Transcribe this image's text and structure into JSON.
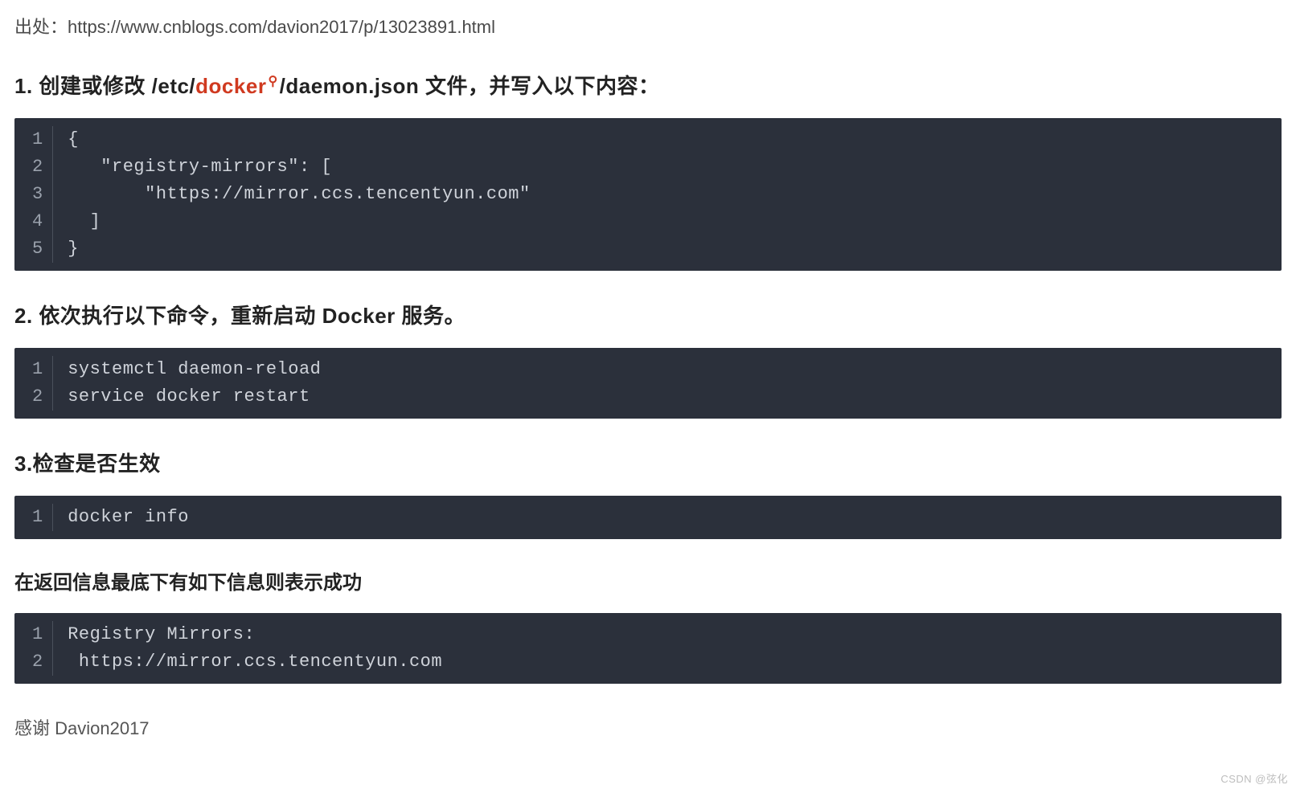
{
  "source": {
    "label": "出处：",
    "url": "https://www.cnblogs.com/davion2017/p/13023891.html"
  },
  "sections": {
    "s1": {
      "prefix": "1. 创建或修改 /etc/",
      "keyword": "docker",
      "suffix": "/daemon.json 文件，并写入以下内容：",
      "code": [
        "{",
        "   \"registry-mirrors\": [",
        "       \"https://mirror.ccs.tencentyun.com\"",
        "  ]",
        "}"
      ]
    },
    "s2": {
      "title": "2. 依次执行以下命令，重新启动 Docker 服务。",
      "code": [
        "systemctl daemon-reload",
        "service docker restart"
      ]
    },
    "s3": {
      "title": "3.检查是否生效",
      "code": [
        "docker info"
      ]
    },
    "s4": {
      "title": "在返回信息最底下有如下信息则表示成功",
      "code": [
        "Registry Mirrors:",
        " https://mirror.ccs.tencentyun.com"
      ]
    }
  },
  "thanks": "感谢 Davion2017",
  "watermark": "CSDN @弦化",
  "icons": {
    "magnifier": "⚲"
  }
}
